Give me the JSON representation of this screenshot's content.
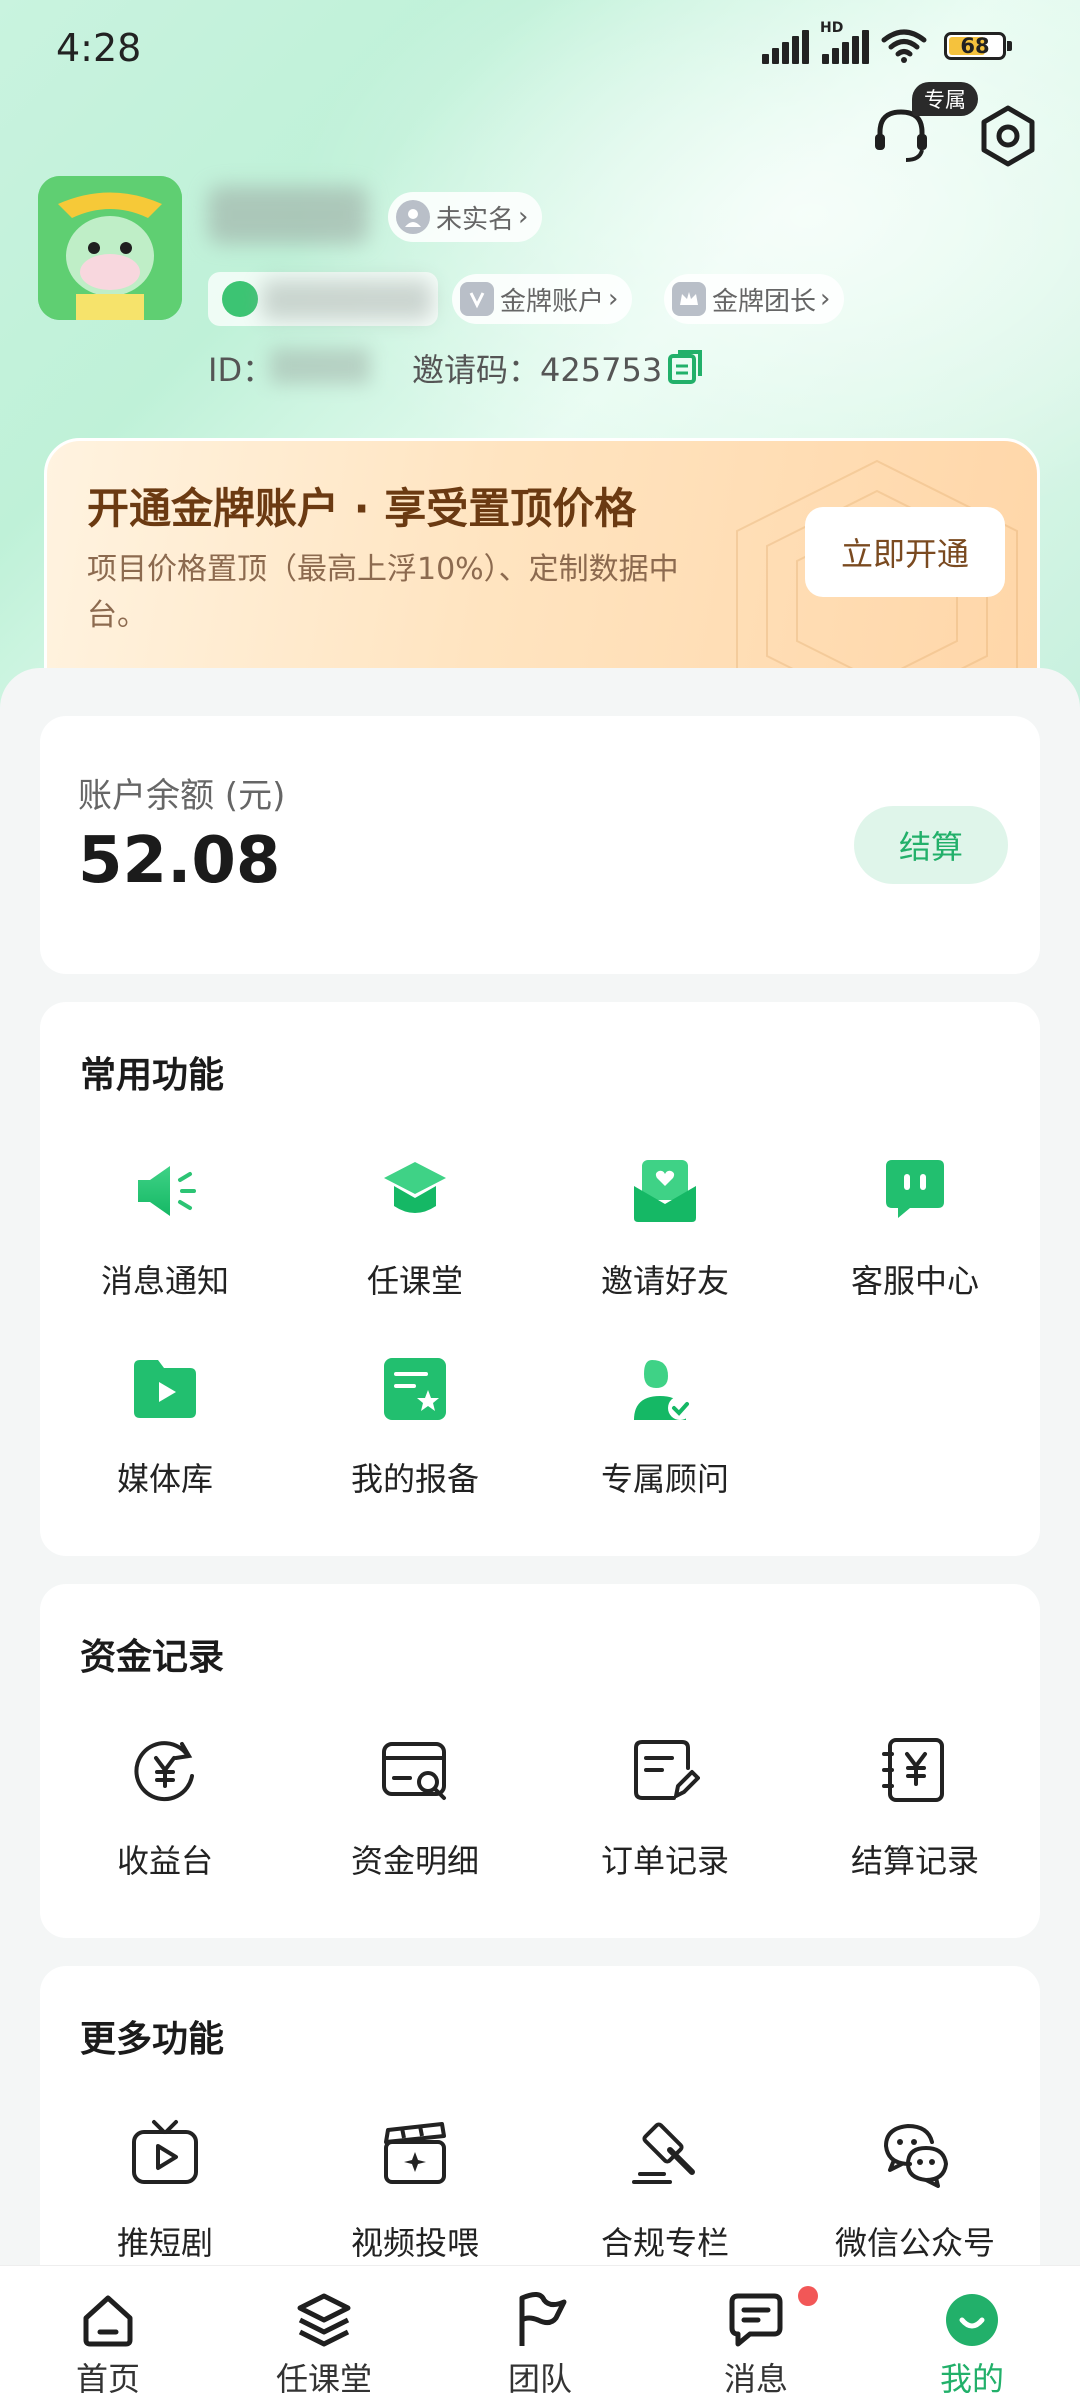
{
  "status_bar": {
    "time": "4:28",
    "hd": "HD",
    "battery": "68"
  },
  "header": {
    "exclusive_tag": "专属",
    "realname_badge": "未实名",
    "gold_account_badge": "金牌账户",
    "gold_leader_badge": "金牌团长",
    "id_label": "ID：",
    "invite_label": "邀请码：",
    "invite_code": "425753"
  },
  "banner": {
    "title": "开通金牌账户 · 享受置顶价格",
    "subtitle": "项目价格置顶（最高上浮10%）、定制数据中台。",
    "button": "立即开通"
  },
  "balance": {
    "label": "账户余额 (元)",
    "value": "52.08",
    "settle_button": "结算"
  },
  "common_functions": {
    "title": "常用功能",
    "items": [
      {
        "label": "消息通知",
        "icon": "megaphone-icon"
      },
      {
        "label": "任课堂",
        "icon": "graduation-cap-icon"
      },
      {
        "label": "邀请好友",
        "icon": "invite-envelope-icon"
      },
      {
        "label": "客服中心",
        "icon": "chat-bubble-icon"
      },
      {
        "label": "媒体库",
        "icon": "folder-play-icon"
      },
      {
        "label": "我的报备",
        "icon": "star-doc-icon"
      },
      {
        "label": "专属顾问",
        "icon": "advisor-icon"
      }
    ]
  },
  "fund_records": {
    "title": "资金记录",
    "items": [
      {
        "label": "收益台",
        "icon": "yuan-refresh-icon"
      },
      {
        "label": "资金明细",
        "icon": "card-search-icon"
      },
      {
        "label": "订单记录",
        "icon": "order-edit-icon"
      },
      {
        "label": "结算记录",
        "icon": "yuan-receipt-icon"
      }
    ]
  },
  "more_functions": {
    "title": "更多功能",
    "items": [
      {
        "label": "推短剧",
        "icon": "tv-play-icon"
      },
      {
        "label": "视频投喂",
        "icon": "clapperboard-icon"
      },
      {
        "label": "合规专栏",
        "icon": "gavel-icon"
      },
      {
        "label": "微信公众号",
        "icon": "wechat-icon"
      }
    ]
  },
  "tabbar": {
    "tabs": [
      {
        "label": "首页",
        "icon": "home-icon"
      },
      {
        "label": "任课堂",
        "icon": "cube-icon"
      },
      {
        "label": "团队",
        "icon": "flag-icon"
      },
      {
        "label": "消息",
        "icon": "message-icon"
      },
      {
        "label": "我的",
        "icon": "profile-icon"
      }
    ],
    "active_index": 4
  },
  "colors": {
    "accent": "#22b06a",
    "gold_text": "#6b3a12",
    "badge_red": "#f25757"
  }
}
